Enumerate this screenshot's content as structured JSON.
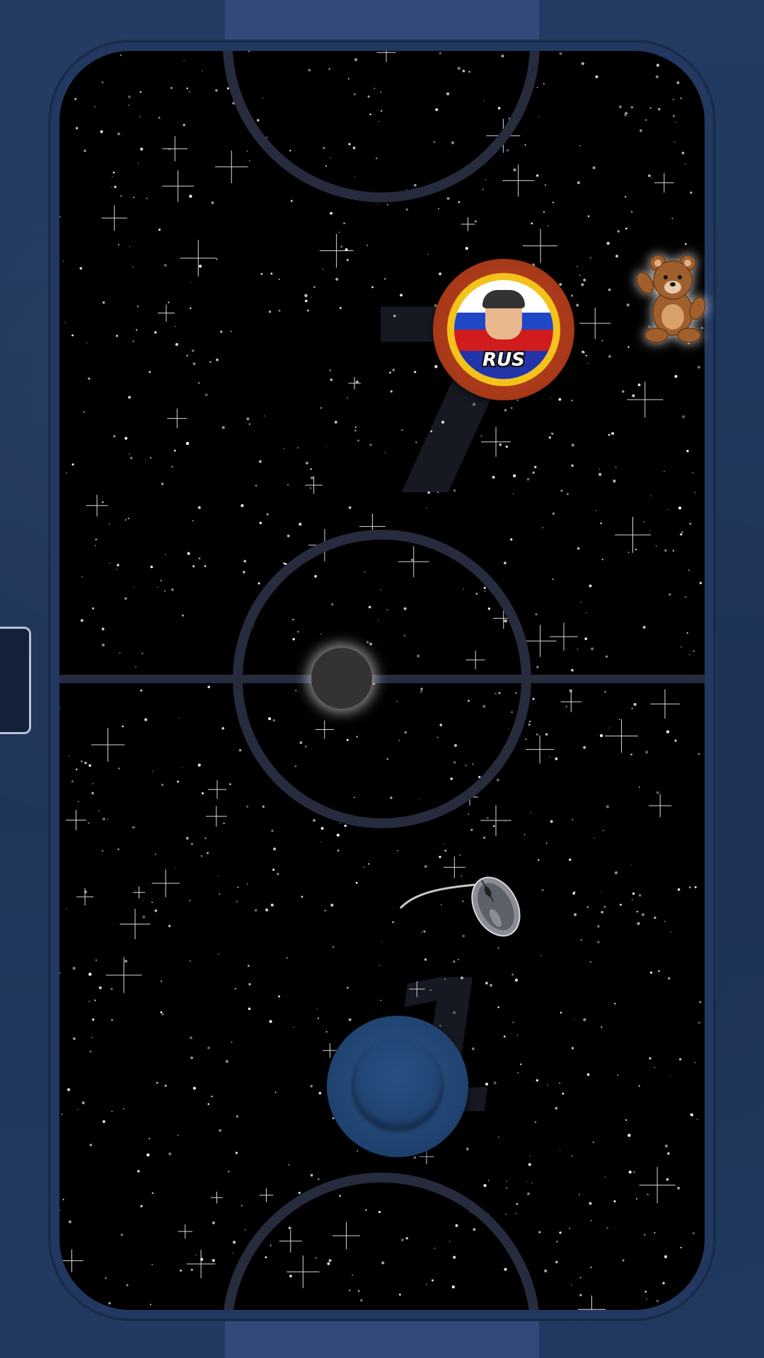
{
  "score": {
    "opponent": "7",
    "player": "1"
  },
  "opponent": {
    "country_code": "RUS",
    "paddle_color": "#a63818",
    "ring_color": "#f4c21a"
  },
  "player": {
    "paddle_color": "#214472"
  },
  "colors": {
    "frame": "#1f3358",
    "goal": "#34497a",
    "rink": "#000000",
    "lines": "#262b3e",
    "puck": "#333333"
  },
  "powerups": [
    {
      "name": "teddy-bear-icon"
    },
    {
      "name": "computer-mouse-icon"
    }
  ]
}
